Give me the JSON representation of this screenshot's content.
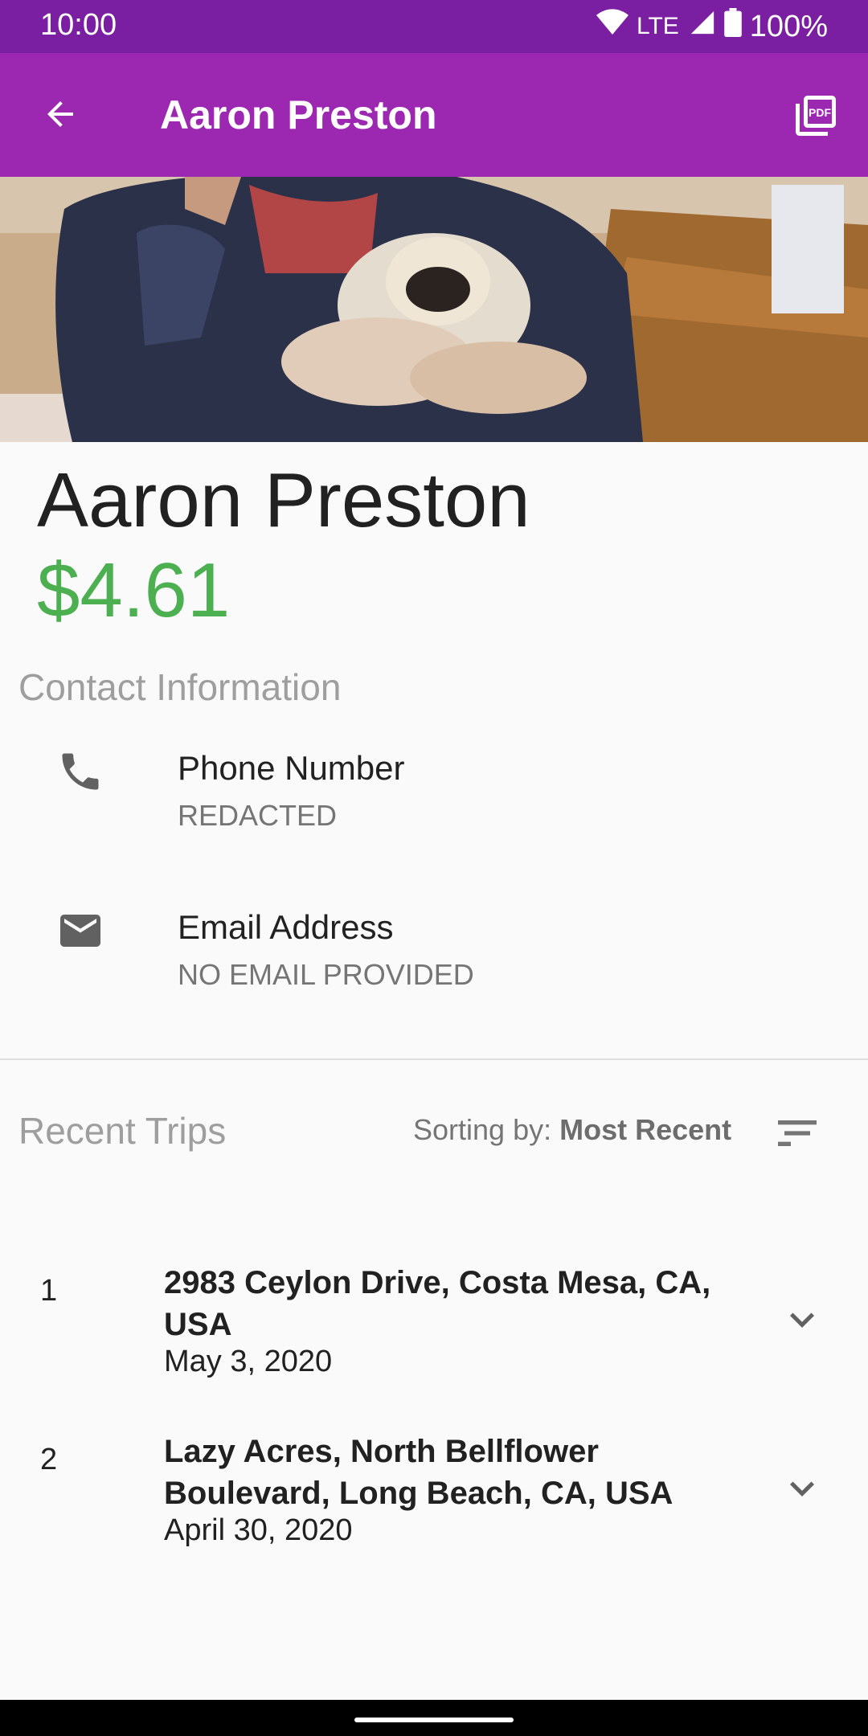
{
  "status_bar": {
    "time": "10:00",
    "network": "LTE",
    "battery": "100%",
    "icons": [
      "wifi-icon",
      "cell-signal-icon",
      "battery-icon"
    ]
  },
  "app_bar": {
    "title": "Aaron Preston",
    "back_icon": "arrow-back-icon",
    "pdf_icon": "pdf-export-icon",
    "background": "#9c27b0"
  },
  "profile": {
    "name": "Aaron Preston",
    "balance": "$4.61",
    "balance_color": "#4caf50"
  },
  "contact": {
    "title": "Contact Information",
    "items": [
      {
        "icon": "phone-icon",
        "label": "Phone Number",
        "value": "REDACTED"
      },
      {
        "icon": "email-icon",
        "label": "Email Address",
        "value": "NO EMAIL PROVIDED"
      }
    ]
  },
  "trips": {
    "title": "Recent Trips",
    "sort_prefix": "Sorting by: ",
    "sort_value": "Most Recent",
    "sort_icon": "sort-icon",
    "items": [
      {
        "number": "1",
        "address_line1": "2983 Ceylon Drive, Costa Mesa, CA,",
        "address_line2": "USA",
        "date": "May 3, 2020"
      },
      {
        "number": "2",
        "address_line1": "Lazy Acres, North Bellflower",
        "address_line2": "Boulevard, Long Beach, CA, USA",
        "date": "April 30, 2020"
      }
    ]
  }
}
